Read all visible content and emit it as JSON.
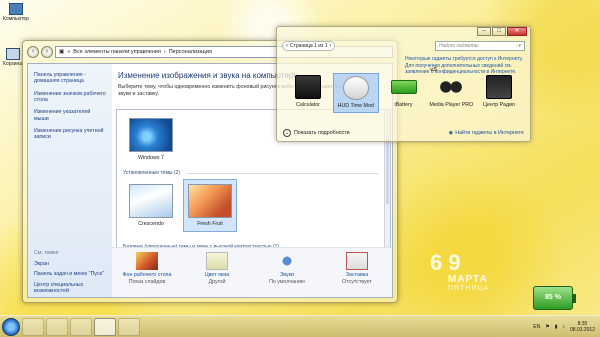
{
  "desktop": {
    "icons": [
      {
        "label": "Компьютер",
        "icon": "computer-icon"
      },
      {
        "label": "Корзина",
        "icon": "recycle-bin-icon"
      }
    ]
  },
  "explorer": {
    "breadcrumb": [
      "Все элементы панели управления",
      "Персонализация"
    ],
    "sidebar": {
      "home": "Панель управления - домашняя страница",
      "items": [
        "Изменение значков рабочего стола",
        "Изменение указателей мыши",
        "Изменение рисунка учетной записи"
      ],
      "see_also": "См. также",
      "bottom_links": [
        "Экран",
        "Панель задач и меню \"Пуск\"",
        "Центр специальных возможностей"
      ]
    },
    "title": "Изменение изображения и звука на компьютере",
    "subtitle": "Выберите тему, чтобы одновременно изменить фоновый рисунок рабочего стола, цвет окна, звуки и заставку.",
    "themes": {
      "windows7": "Windows 7",
      "installed_label": "Установленные темы (2)",
      "installed": [
        "Crescendo",
        "Fresh Fruit"
      ],
      "basic_label": "Базовые (упрощенные) темы и темы с высокой контрастностью (1)"
    },
    "bottom": [
      {
        "link": "Фон рабочего стола",
        "value": "Показ слайдов",
        "icon": "desktop-background-icon"
      },
      {
        "link": "Цвет окна",
        "value": "Другой",
        "icon": "window-color-icon"
      },
      {
        "link": "Звуки",
        "value": "По умолчанию",
        "icon": "sounds-icon"
      },
      {
        "link": "Заставка",
        "value": "Отсутствует",
        "icon": "screensaver-icon"
      }
    ]
  },
  "gadgets": {
    "pager": "Страница 1 из 1",
    "search_placeholder": "Найти гаджеты",
    "notice": "Некоторые гаджеты требуется доступ к Интернету. Для получения дополнительных сведений см. заявление о конфиденциальности в Интернете.",
    "items": [
      {
        "label": "Calculator",
        "icon": "calculator-icon"
      },
      {
        "label": "HUD Time Mod",
        "icon": "clock-icon",
        "selected": true
      },
      {
        "label": "iBattery",
        "icon": "battery-icon"
      },
      {
        "label": "Media Player PRO",
        "icon": "headphones-icon",
        "tag": "v.5"
      },
      {
        "label": "Центр Радио",
        "icon": "radio-icon"
      }
    ],
    "details": "Показать подробности",
    "online": "Найти гаджеты в Интернете"
  },
  "clock": {
    "digits": "6 9",
    "date": "МАРТА",
    "day": "ПЯТНИЦА"
  },
  "battery": {
    "percent": "85 %",
    "level": 0.85
  },
  "taskbar": {
    "lang": "EN",
    "time": "8:35",
    "date": "08.03.2012"
  }
}
